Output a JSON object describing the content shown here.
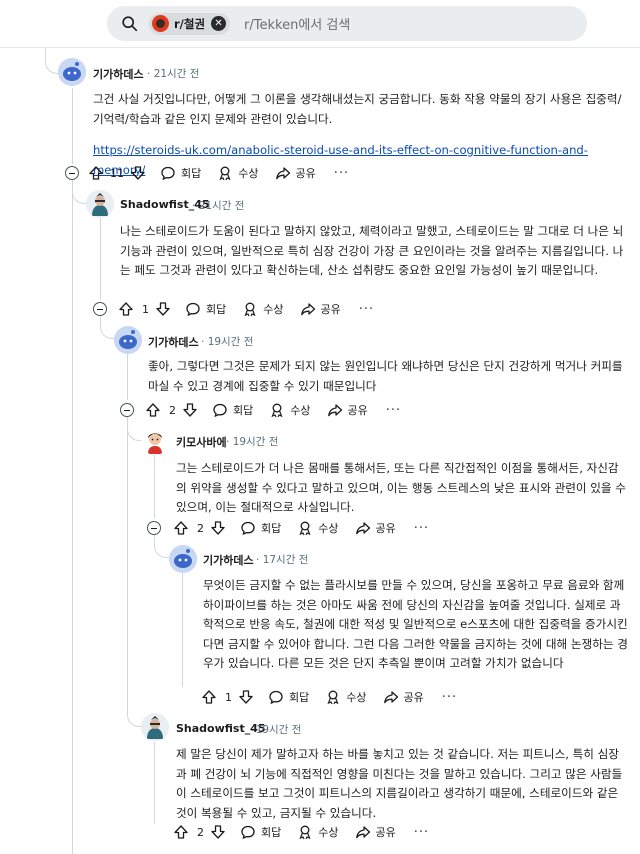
{
  "search": {
    "subreddit_chip": "r/철권",
    "placeholder": "r/Tekken에서 검색"
  },
  "actions_labels": {
    "reply": "회답",
    "award": "수상",
    "share": "공유",
    "more": "···"
  },
  "comments": [
    {
      "user": "기가하데스",
      "time": "21시간 전",
      "text": "그건 사실 거짓입니다만, 어떻게 그 이론을 생각해내셨는지 궁금합니다. 동화 작용 약물의 장기 사용은 집중력/기억력/학습과 같은 인지 문제와 관련이 있습니다.",
      "link": "https://steroids-uk.com/anabolic-steroid-use-and-its-effect-on-cognitive-function-and-memory/",
      "votes": "11"
    },
    {
      "user": "Shadowfist_45",
      "time": "21시간 전",
      "text": "나는 스테로이드가 도움이 된다고 말하지 않았고, 체력이라고 말했고, 스테로이드는 말 그대로 더 나은 뇌 기능과 관련이 있으며, 일반적으로 특히 심장 건강이 가장 큰 요인이라는 것을 알려주는 지름길입니다. 나는 페도 그것과 관련이 있다고 확신하는데, 산소 섭취량도 중요한 요인일 가능성이 높기 때문입니다.",
      "votes": "1"
    },
    {
      "user": "기가하데스",
      "time": "19시간 전",
      "text": "좋아, 그렇다면 그것은 문제가 되지 않는 원인입니다 왜냐하면 당신은 단지 건강하게 먹거나 커피를 마실 수 있고 경계에 집중할 수 있기 때문입니다",
      "votes": "2"
    },
    {
      "user": "키모사바에",
      "time": "19시간 전",
      "text": "그는 스테로이드가 더 나은 몸매를 통해서든, 또는 다른 직간접적인 이점을 통해서든, 자신감의 위약을 생성할 수 있다고 말하고 있으며, 이는 행동 스트레스의 낮은 표시와 관련이 있을 수 있으며, 이는 절대적으로 사실입니다.",
      "votes": "2"
    },
    {
      "user": "기가하데스",
      "time": "17시간 전",
      "text": "무엇이든 금지할 수 없는 플라시보를 만들 수 있으며, 당신을 포옹하고 무료 음료와 함께 하이파이브를 하는 것은 아마도 싸움 전에 당신의 자신감을 높여줄 것입니다. 실제로 과학적으로 반응 속도, 철권에 대한 적성 및 일반적으로 e스포츠에 대한 집중력을 증가시킨다면 금지할 수 있어야 합니다. 그런 다음 그러한 약물을 금지하는 것에 대해 논쟁하는 경우가 있습니다. 다른 모든 것은 단지 추측일 뿐이며 고려할 가치가 없습니다",
      "votes": "1"
    },
    {
      "user": "Shadowfist_45",
      "time": "19시간 전",
      "text": "제 말은 당신이 제가 말하고자 하는 바를 놓치고 있는 것 같습니다. 저는 피트니스, 특히 심장과 폐 건강이 뇌 기능에 직접적인 영향을 미친다는 것을 말하고 있습니다. 그리고 많은 사람들이 스테로이드를 보고 그것이 피트니스의 지름길이라고 생각하기 때문에, 스테로이드와 같은 것이 복용될 수 있고, 금지될 수 있습니다.",
      "votes": "2"
    }
  ]
}
